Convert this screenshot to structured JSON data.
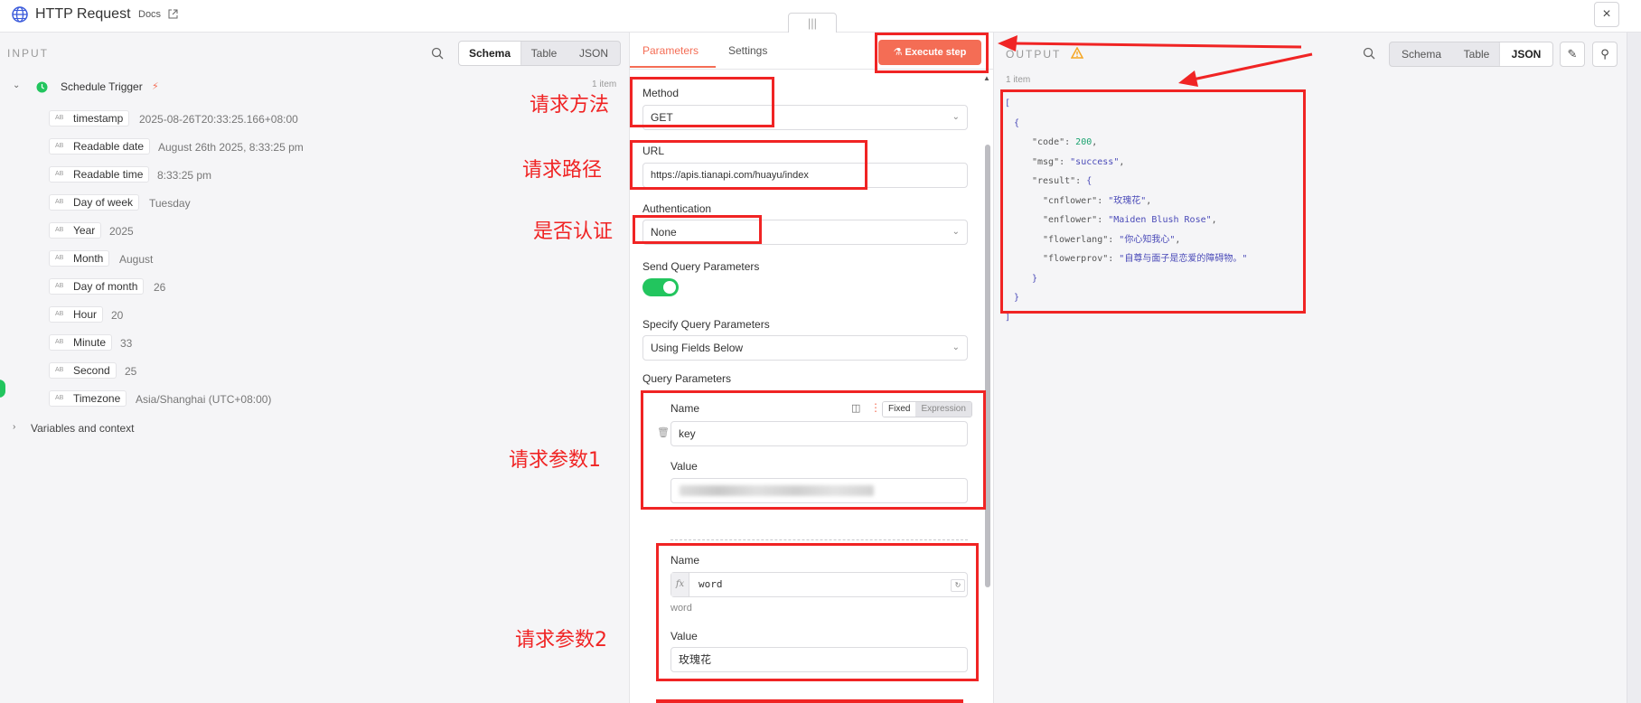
{
  "header": {
    "title": "HTTP Request",
    "docs_link": "Docs",
    "close_symbol": "×",
    "drag_handle": "|||"
  },
  "input_panel": {
    "heading": "INPUT",
    "view_tabs": [
      "Schema",
      "Table",
      "JSON"
    ],
    "active_tab": "Schema",
    "item_count": "1 item",
    "trigger_name": "Schedule Trigger",
    "type_badge": "AB",
    "fields": [
      {
        "name": "timestamp",
        "value": "2025-08-26T20:33:25.166+08:00"
      },
      {
        "name": "Readable date",
        "value": "August 26th 2025, 8:33:25 pm"
      },
      {
        "name": "Readable time",
        "value": "8:33:25 pm"
      },
      {
        "name": "Day of week",
        "value": "Tuesday"
      },
      {
        "name": "Year",
        "value": "2025"
      },
      {
        "name": "Month",
        "value": "August"
      },
      {
        "name": "Day of month",
        "value": "26"
      },
      {
        "name": "Hour",
        "value": "20"
      },
      {
        "name": "Minute",
        "value": "33"
      },
      {
        "name": "Second",
        "value": "25"
      },
      {
        "name": "Timezone",
        "value": "Asia/Shanghai (UTC+08:00)"
      }
    ],
    "variables_label": "Variables and context"
  },
  "parameters_panel": {
    "tabs": [
      "Parameters",
      "Settings"
    ],
    "active_tab": "Parameters",
    "execute_label": "Execute step",
    "method_label": "Method",
    "method_value": "GET",
    "url_label": "URL",
    "url_value": "https://apis.tianapi.com/huayu/index",
    "auth_label": "Authentication",
    "auth_value": "None",
    "send_query_label": "Send Query Parameters",
    "send_query_enabled": true,
    "specify_query_label": "Specify Query Parameters",
    "specify_query_value": "Using Fields Below",
    "query_params_label": "Query Parameters",
    "fixed_label": "Fixed",
    "expression_label": "Expression",
    "params": [
      {
        "name_label": "Name",
        "name": "key",
        "value_label": "Value"
      },
      {
        "name_label": "Name",
        "name": "word",
        "name_preview": "word",
        "value_label": "Value",
        "value": "玫瑰花"
      }
    ]
  },
  "output_panel": {
    "heading": "OUTPUT",
    "view_tabs": [
      "Schema",
      "Table",
      "JSON"
    ],
    "active_tab": "JSON",
    "item_count": "1 item",
    "json": {
      "code": "200",
      "msg": "\"success\"",
      "cnflower": "\"玫瑰花\"",
      "enflower": "\"Maiden Blush Rose\"",
      "flowerlang": "\"你心知我心\"",
      "flowerprov": "\"自尊与面子是恋爱的障碍物。\""
    }
  },
  "annotations": {
    "method": "请求方法",
    "url": "请求路径",
    "auth": "是否认证",
    "param1": "请求参数1",
    "param2": "请求参数2"
  },
  "colors": {
    "accent": "#ff6d5a",
    "annotation_red": "#f02424",
    "toggle_on": "#22c55e",
    "trigger_green": "#22c55e"
  }
}
